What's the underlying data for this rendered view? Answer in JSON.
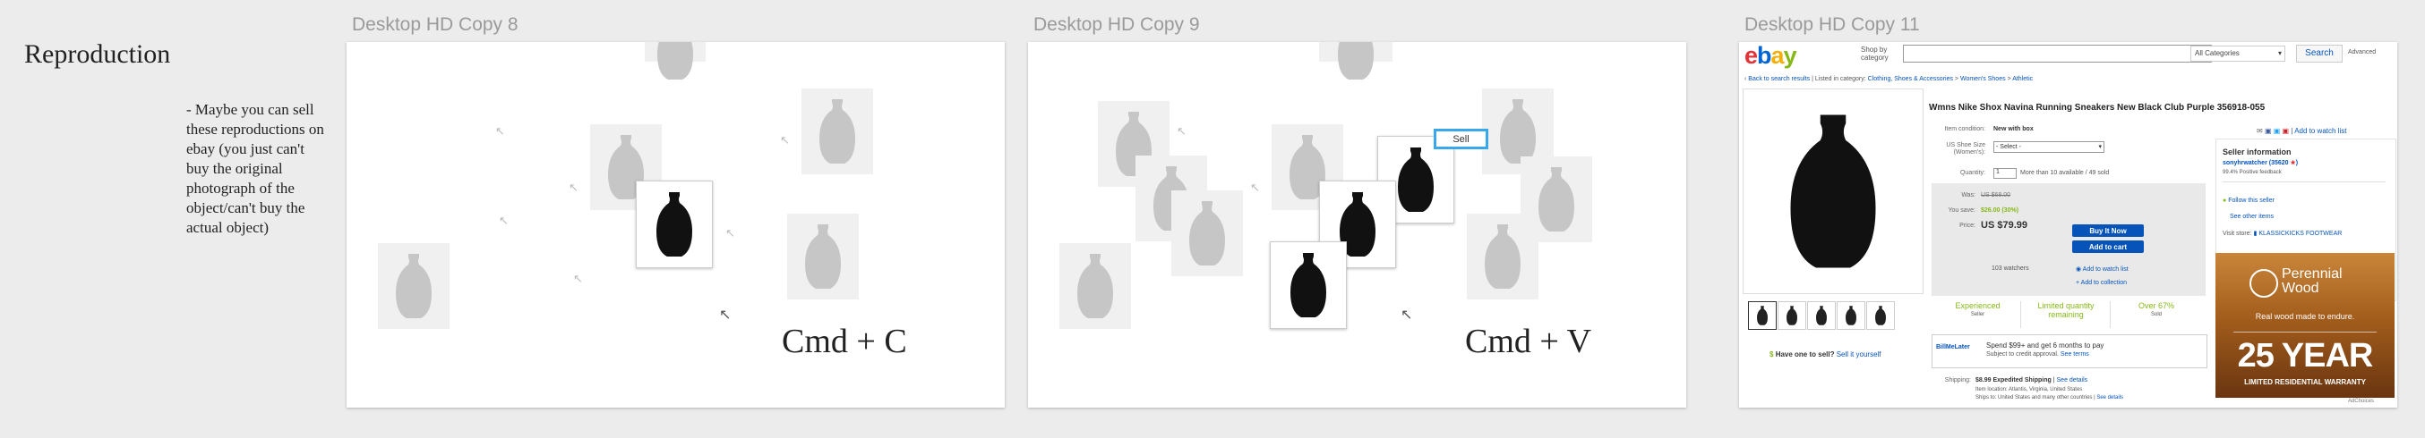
{
  "sidebar": {
    "title": "Reproduction",
    "note": "- Maybe you can sell these reproductions on ebay (you just can't buy the original photograph of the object/can't buy the actual object)"
  },
  "artboards": [
    {
      "label": "Desktop HD Copy 8",
      "shortcut": "Cmd + C"
    },
    {
      "label": "Desktop HD Copy 9",
      "shortcut": "Cmd + V",
      "sell_label": "Sell"
    },
    {
      "label": "Desktop HD Copy 11"
    }
  ],
  "ebay": {
    "logo": "ebay",
    "shop_by": "Shop by category",
    "search_category": "All Categories",
    "search_button": "Search",
    "advanced": "Advanced",
    "back": "Back to search results",
    "listed_in": "Listed in category:",
    "breadcrumb": [
      "Clothing, Shoes & Accessories",
      "Women's Shoes",
      "Athletic"
    ],
    "title": "Wmns Nike Shox Navina Running Sneakers New Black Club Purple 356918-055",
    "share": "Add to watch list",
    "item_condition_label": "Item condition:",
    "item_condition": "New with box",
    "size_label": "US Shoe Size (Women's):",
    "size_select": "- Select -",
    "quantity_label": "Quantity:",
    "quantity_value": "1",
    "quantity_note": "More than 10 available / 49 sold",
    "was_label": "Was:",
    "was_price": "US $68.00",
    "save_label": "You save:",
    "save_amount": "$26.00 (30%)",
    "price_label": "Price:",
    "price": "US $79.99",
    "buy_now": "Buy It Now",
    "add_to_cart": "Add to cart",
    "watchers": "103 watchers",
    "add_watch": "Add to watch list",
    "add_collection": "Add to collection",
    "badges": [
      {
        "top": "Experienced",
        "bottom": "Seller"
      },
      {
        "top": "Limited quantity",
        "bottom": "remaining"
      },
      {
        "top": "Over 67%",
        "bottom": "Sold"
      }
    ],
    "have_one": "Have one to sell?",
    "sell_it": "Sell it yourself",
    "billme": "BillMeLater",
    "billme_text": "Spend $99+ and get 6 months to pay",
    "billme_sub": "Subject to credit approval.",
    "see_terms": "See terms",
    "shipping_label": "Shipping:",
    "shipping": "$8.99  Expedited Shipping",
    "see_details": "See details",
    "item_location": "Item location: Atlantis, Virginia, United States",
    "ships_to": "Ships to: United States and many other countries",
    "seller_info": "Seller information",
    "seller_name": "sonyhrwatcher (35620",
    "seller_feedback": "99.4% Positive feedback",
    "follow": "Follow this seller",
    "see_other": "See other items",
    "visit_store": "Visit store:",
    "store_name": "KLASSICKICKS FOOTWEAR",
    "ad_brand": "Perennial Wood",
    "ad_tagline": "Real wood made to endure.",
    "ad_big": "25 YEAR",
    "ad_warranty": "LIMITED RESIDENTIAL WARRANTY",
    "ad_choices": "AdChoices"
  }
}
